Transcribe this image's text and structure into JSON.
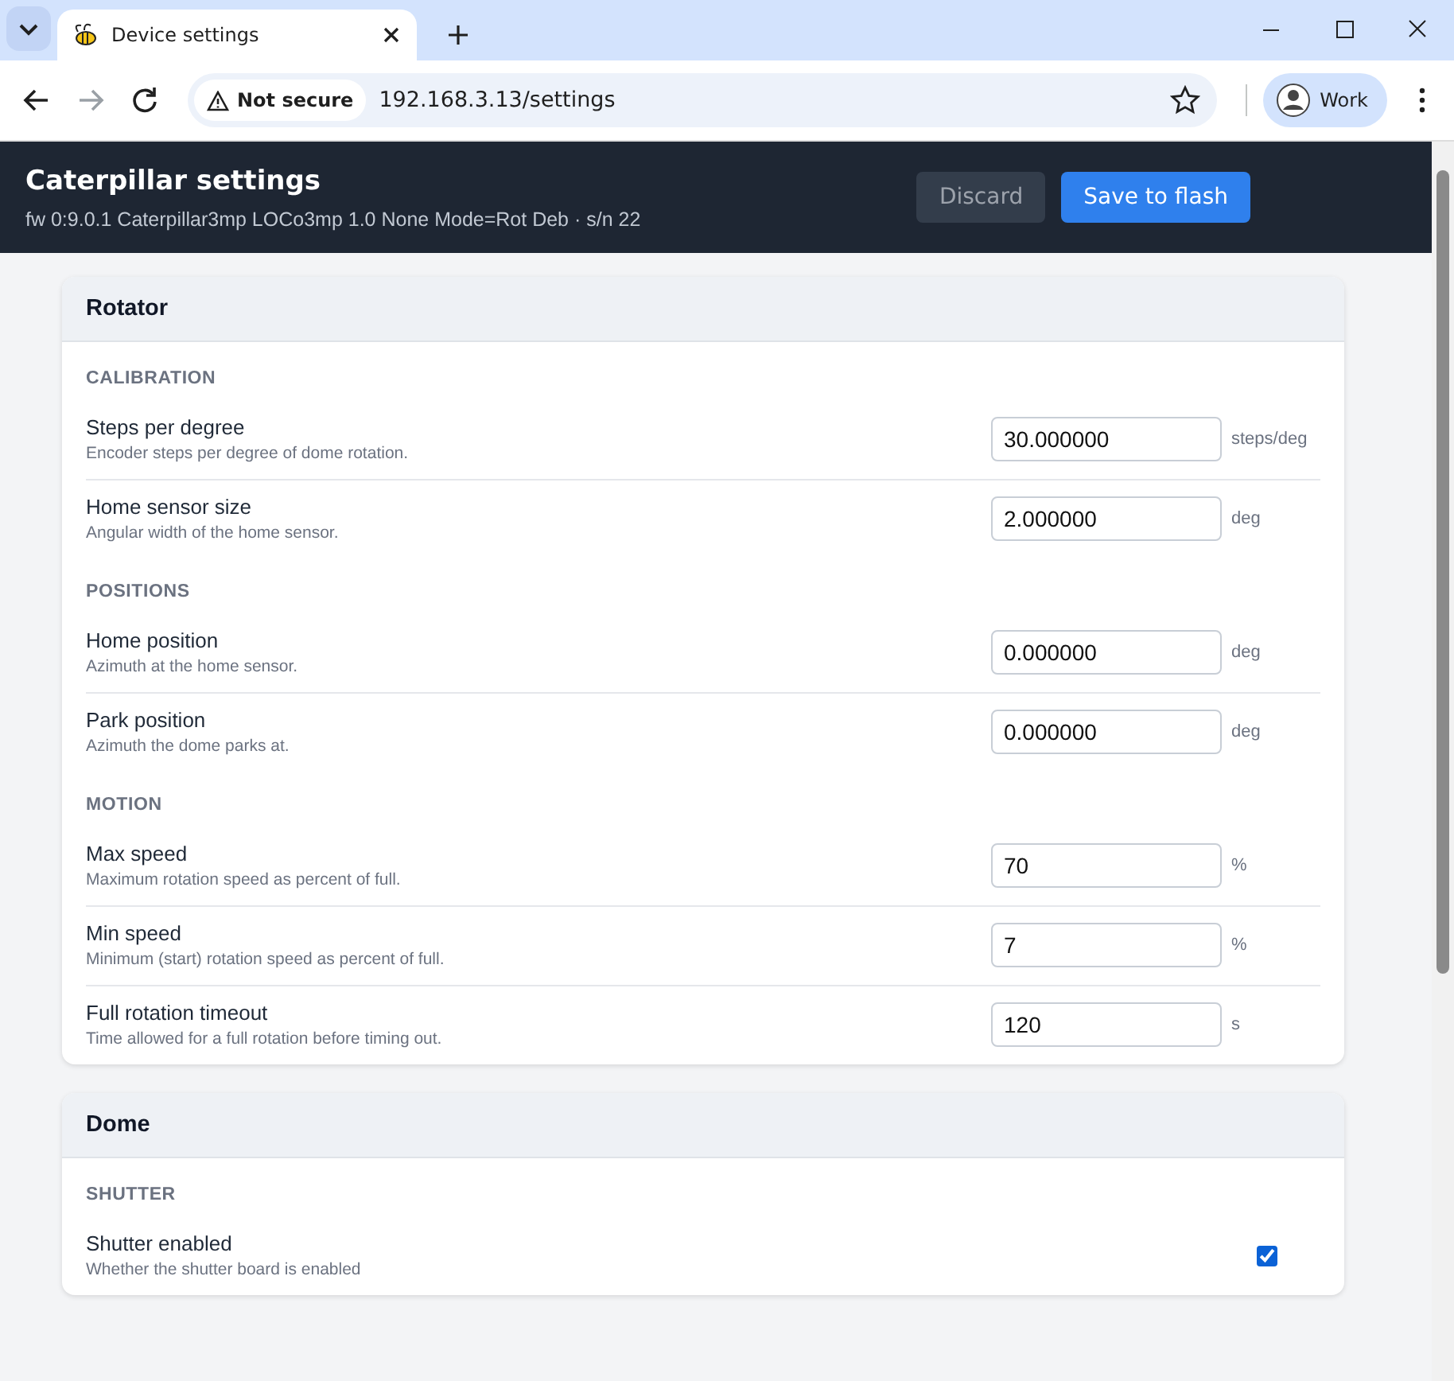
{
  "browser": {
    "tab_title": "Device settings",
    "security_label": "Not secure",
    "url": "192.168.3.13/settings",
    "profile": "Work"
  },
  "header": {
    "title": "Caterpillar settings",
    "subtitle": "fw 0:9.0.1 Caterpillar3mp LOCo3mp 1.0 None Mode=Rot Deb · s/n 22",
    "buttons": [
      {
        "label": "Discard",
        "kind": "secondary",
        "disabled": true
      },
      {
        "label": "Save to flash",
        "kind": "primary",
        "disabled": false
      }
    ]
  },
  "sections": [
    {
      "title": "Rotator",
      "groups": [
        {
          "heading": "CALIBRATION",
          "fields": [
            {
              "kind": "number",
              "label": "Steps per degree",
              "description": "Encoder steps per degree of dome rotation.",
              "value": "30.000000",
              "unit": "steps/deg"
            },
            {
              "kind": "number",
              "label": "Home sensor size",
              "description": "Angular width of the home sensor.",
              "value": "2.000000",
              "unit": "deg"
            }
          ]
        },
        {
          "heading": "POSITIONS",
          "fields": [
            {
              "kind": "number",
              "label": "Home position",
              "description": "Azimuth at the home sensor.",
              "value": "0.000000",
              "unit": "deg"
            },
            {
              "kind": "number",
              "label": "Park position",
              "description": "Azimuth the dome parks at.",
              "value": "0.000000",
              "unit": "deg"
            }
          ]
        },
        {
          "heading": "MOTION",
          "fields": [
            {
              "kind": "number",
              "label": "Max speed",
              "description": "Maximum rotation speed as percent of full.",
              "value": "70",
              "unit": "%"
            },
            {
              "kind": "number",
              "label": "Min speed",
              "description": "Minimum (start) rotation speed as percent of full.",
              "value": "7",
              "unit": "%"
            },
            {
              "kind": "number",
              "label": "Full rotation timeout",
              "description": "Time allowed for a full rotation before timing out.",
              "value": "120",
              "unit": "s"
            }
          ]
        }
      ]
    },
    {
      "title": "Dome",
      "groups": [
        {
          "heading": "SHUTTER",
          "fields": [
            {
              "kind": "checkbox",
              "label": "Shutter enabled",
              "description": "Whether the shutter board is enabled",
              "checked": true
            }
          ]
        }
      ]
    }
  ]
}
